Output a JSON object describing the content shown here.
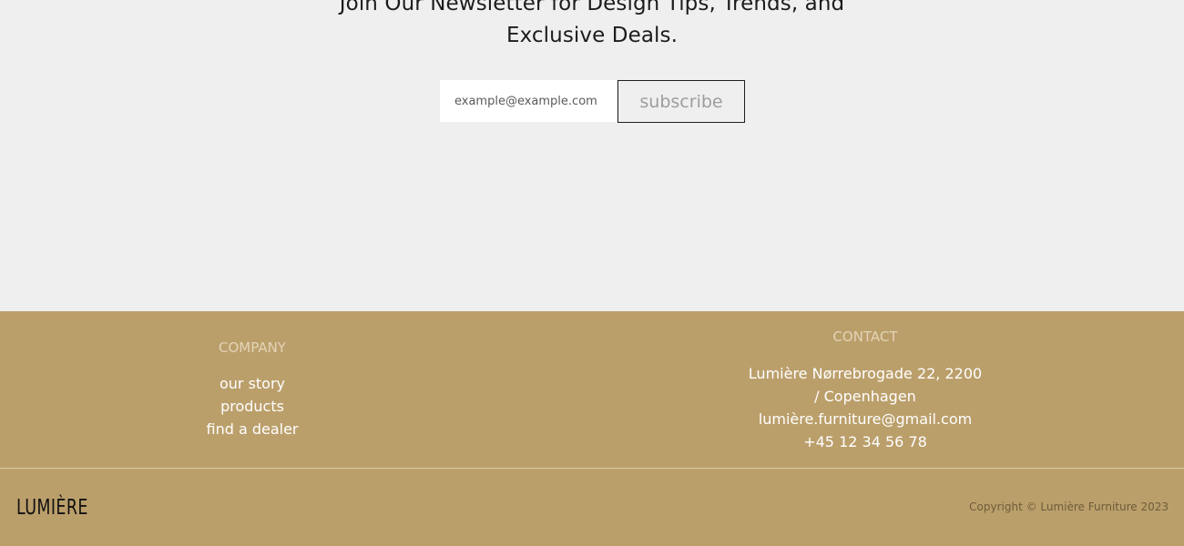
{
  "newsletter": {
    "heading_line_1": "Join Our Newsletter for Design Tips, Trends, and",
    "heading_line_2": "Exclusive Deals.",
    "email_placeholder": "example@example.com",
    "email_value": "",
    "subscribe_label": "subscribe"
  },
  "footer": {
    "company": {
      "heading": "COMPANY",
      "links": [
        "our story",
        "products",
        "find a dealer"
      ]
    },
    "contact": {
      "heading": "CONTACT",
      "address_line_1": "Lumière Nørrebrogade 22, 2200",
      "address_line_2": "/ Copenhagen",
      "email": "lumière.furniture@gmail.com",
      "phone": "+45 12 34 56 78"
    },
    "logo": "LUMIÈRE",
    "copyright": "Copyright © Lumière Furniture 2023"
  },
  "colors": {
    "page_background": "#efefef",
    "footer_background": "#bb9f6b",
    "footer_heading": "#e3d4b6",
    "footer_text": "#ffffff"
  }
}
